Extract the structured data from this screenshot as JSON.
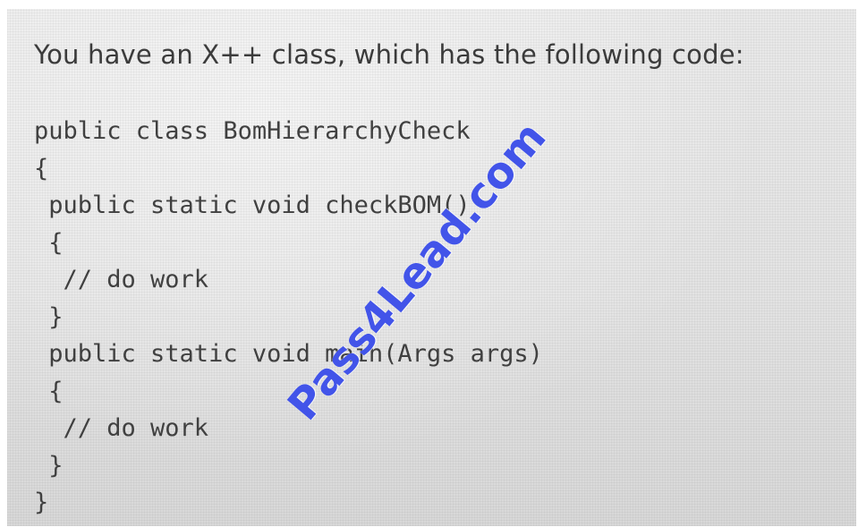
{
  "question": {
    "intro": "You have an X++ class, which has the following code:",
    "code_lines": [
      "public class BomHierarchyCheck",
      "{",
      " public static void checkBOM()",
      " {",
      "  // do work",
      " }",
      " public static void main(Args args)",
      " {",
      "  // do work",
      " }",
      "}"
    ]
  },
  "watermark": {
    "text": "Pass4Lead.com",
    "color": "#2b3ee6"
  }
}
